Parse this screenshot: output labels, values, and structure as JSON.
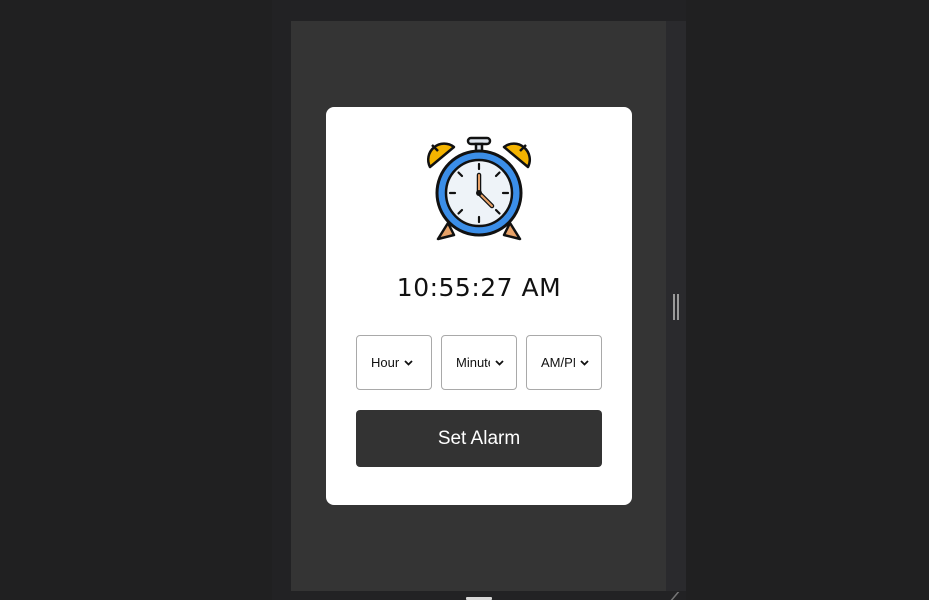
{
  "clock": {
    "icon": "alarm-clock-icon",
    "time": "10:55:27 AM"
  },
  "selects": [
    {
      "value": "Hour"
    },
    {
      "value": "Minute"
    },
    {
      "value": "AM/PM"
    }
  ],
  "button": {
    "label": "Set Alarm"
  },
  "colors": {
    "background": "#202021",
    "viewport": "#343434",
    "card": "#ffffff",
    "button": "#333333",
    "clock_ring": "#3b8ee8",
    "bells": "#f5b400"
  }
}
